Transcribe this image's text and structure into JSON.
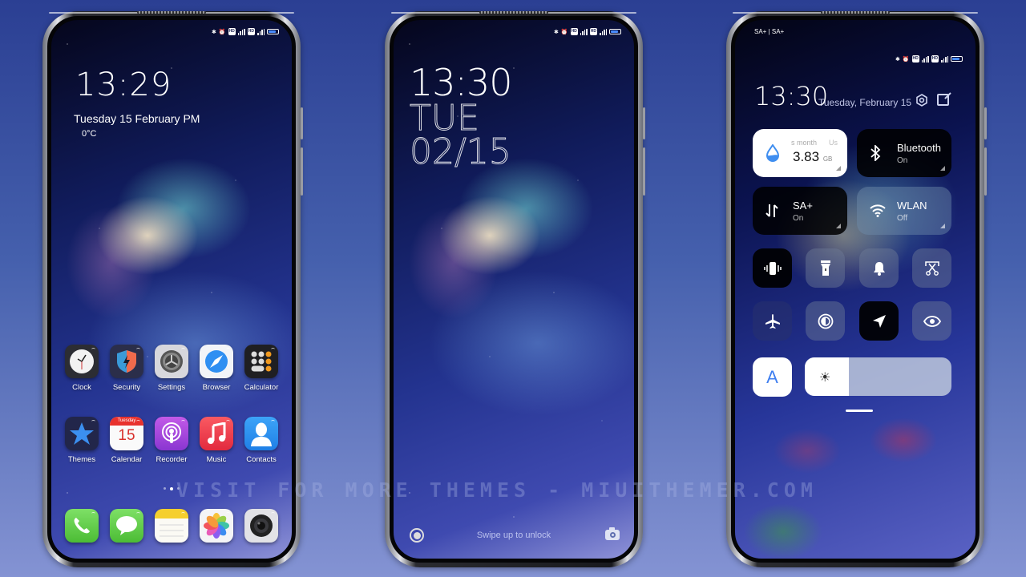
{
  "status_bar": {
    "icons": [
      "bluetooth-icon",
      "alarm-icon",
      "hd-icon",
      "signal-4g-icon",
      "hd-icon",
      "signal-4g-icon",
      "battery-icon"
    ],
    "network_label": "4G",
    "hd_label": "HD",
    "battery_level": 0.8
  },
  "home": {
    "time": "13:29",
    "date": "Tuesday 15 February  PM",
    "temperature": "0°C",
    "apps_row1": [
      {
        "label": "Clock",
        "icon": "clock-icon"
      },
      {
        "label": "Security",
        "icon": "security-shield-icon"
      },
      {
        "label": "Settings",
        "icon": "settings-gear-icon"
      },
      {
        "label": "Browser",
        "icon": "compass-icon"
      },
      {
        "label": "Calculator",
        "icon": "calculator-icon"
      }
    ],
    "apps_row2": [
      {
        "label": "Themes",
        "icon": "star-icon"
      },
      {
        "label": "Calendar",
        "icon": "calendar-icon",
        "day_name": "Tuesday",
        "day_number": "15"
      },
      {
        "label": "Recorder",
        "icon": "podcast-mic-icon"
      },
      {
        "label": "Music",
        "icon": "music-note-icon"
      },
      {
        "label": "Contacts",
        "icon": "person-icon"
      }
    ],
    "page_indicator": {
      "pages": 3,
      "active": 2
    },
    "dock": [
      {
        "name": "phone",
        "icon": "phone-icon"
      },
      {
        "name": "messages",
        "icon": "message-bubble-icon"
      },
      {
        "name": "notes",
        "icon": "notes-icon"
      },
      {
        "name": "gallery",
        "icon": "gallery-pinwheel-icon"
      },
      {
        "name": "camera",
        "icon": "camera-lens-icon"
      }
    ]
  },
  "lock": {
    "time": "13:30",
    "day": "TUE",
    "date": "02/15",
    "hint": "Swipe up to unlock"
  },
  "control_center": {
    "carrier": "SA+ | SA+",
    "time": "13:30",
    "date": "Tuesday, February 15",
    "tiles": {
      "data": {
        "label_partial": "s month",
        "label_right_partial": "Us",
        "value": "3.83",
        "unit": "GB"
      },
      "bluetooth": {
        "title": "Bluetooth",
        "status": "On"
      },
      "mobile_data": {
        "title": "SA+",
        "status": "On"
      },
      "wlan": {
        "title": "WLAN",
        "status": "Off"
      }
    },
    "toggles": [
      {
        "name": "vibrate",
        "state": "on"
      },
      {
        "name": "flashlight",
        "state": "off"
      },
      {
        "name": "sound",
        "state": "off"
      },
      {
        "name": "screenshot",
        "state": "off"
      },
      {
        "name": "airplane-mode",
        "state": "off"
      },
      {
        "name": "dark-mode",
        "state": "off"
      },
      {
        "name": "location",
        "state": "on"
      },
      {
        "name": "reading-mode",
        "state": "off"
      }
    ],
    "auto_brightness_label": "A",
    "brightness": 0.3
  },
  "watermark": "VISIT FOR MORE THEMES - MIUITHEMER.COM",
  "colors": {
    "accent_blue": "#3f7ff0",
    "battery_blue": "#4a8cff",
    "tile_dark": "#000000",
    "tile_light": "#ffffff"
  }
}
